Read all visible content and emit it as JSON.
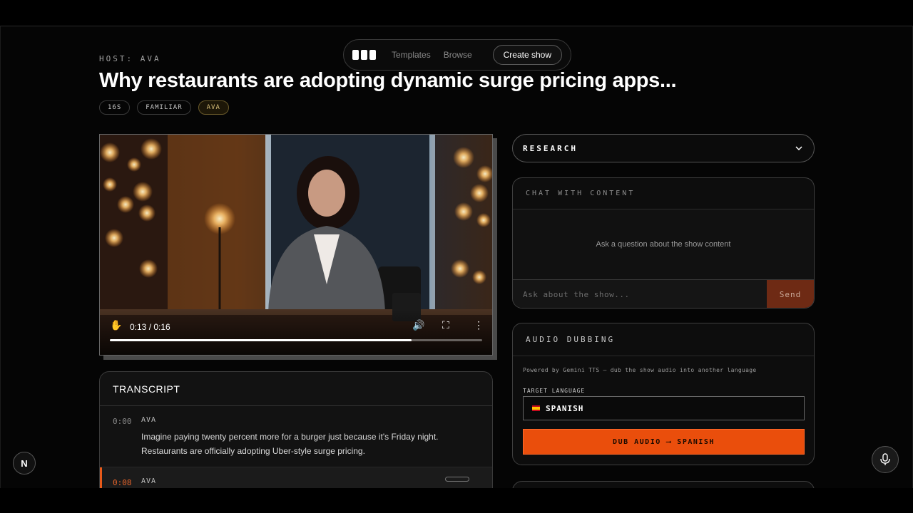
{
  "nav": {
    "links": [
      "Templates",
      "Browse"
    ],
    "create_label": "Create show"
  },
  "show": {
    "host": "HOST: AVA",
    "title": "Why restaurants are adopting dynamic surge pricing apps...",
    "tags": [
      "16S",
      "FAMILIAR",
      "AVA"
    ]
  },
  "video": {
    "time": "0:13 / 0:16",
    "progress": 0.81
  },
  "transcript": {
    "title": "TRANSCRIPT",
    "rows": [
      {
        "time": "0:00",
        "speaker": "AVA",
        "text_1": "Imagine paying twenty percent more for a burger just because it's Friday night.",
        "text_2": "Restaurants are officially adopting Uber-style surge pricing."
      },
      {
        "time": "0:08",
        "speaker": "AVA"
      }
    ]
  },
  "research": {
    "label": "RESEARCH"
  },
  "chat": {
    "title": "CHAT WITH CONTENT",
    "empty": "Ask a question about the show content",
    "placeholder": "Ask about the show...",
    "send": "Send"
  },
  "dubbing": {
    "title": "AUDIO DUBBING",
    "description": "Powered by Gemini TTS — dub the show audio into another language",
    "target_label": "TARGET LANGUAGE",
    "language": "SPANISH",
    "button": "DUB AUDIO ⟶ SPANISH"
  },
  "badge": "N",
  "colors": {
    "accent": "#ea4e0c",
    "active_time": "#e8642a"
  }
}
